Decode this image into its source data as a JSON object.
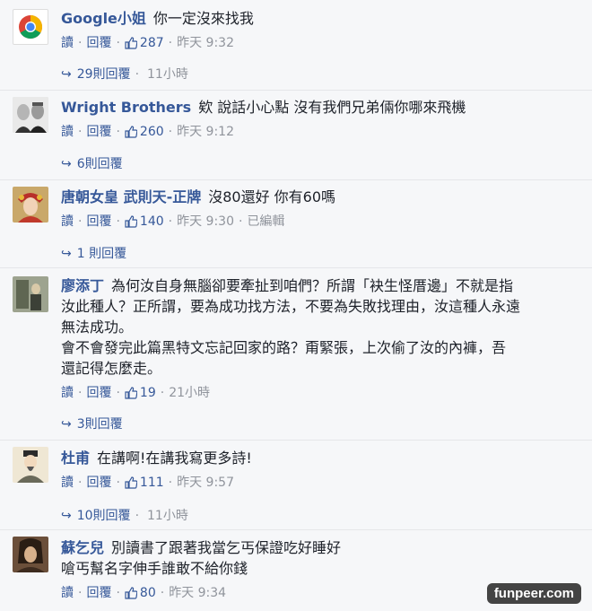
{
  "comments": [
    {
      "author": "Google小姐",
      "text": [
        "你一定沒來找我"
      ],
      "actions": {
        "read": "讀",
        "reply": "回覆",
        "likes": "287",
        "time": "昨天 9:32"
      },
      "replies": {
        "count": "29則回覆",
        "meta": "11小時"
      }
    },
    {
      "author": "Wright Brothers",
      "text": [
        "欸 說話小心點 沒有我們兄弟倆你哪來飛機"
      ],
      "actions": {
        "read": "讀",
        "reply": "回覆",
        "likes": "260",
        "time": "昨天 9:12"
      },
      "replies": {
        "count": "6則回覆",
        "meta": ""
      }
    },
    {
      "author": "唐朝女皇 武則天-正牌",
      "text": [
        "沒80還好 你有60嗎"
      ],
      "actions": {
        "read": "讀",
        "reply": "回覆",
        "likes": "140",
        "time": "昨天 9:30",
        "edited": "已編輯"
      },
      "replies": {
        "count": "1 則回覆",
        "meta": ""
      }
    },
    {
      "author": "廖添丁",
      "text": [
        "為何汝自身無腦卻要牽扯到咱們？所謂「袂生怪厝邊」不就是指",
        "汝此種人？正所謂，要為成功找方法，不要為失敗找理由，汝這種人永遠",
        "無法成功。",
        "會不會發完此篇黑特文忘記回家的路？甭緊張，上次偷了汝的內褲，吾",
        "還記得怎麼走。"
      ],
      "actions": {
        "read": "讀",
        "reply": "回覆",
        "likes": "19",
        "time": "21小時"
      },
      "replies": {
        "count": "3則回覆",
        "meta": ""
      }
    },
    {
      "author": "杜甫",
      "text": [
        "在講啊!在講我寫更多詩!"
      ],
      "actions": {
        "read": "讀",
        "reply": "回覆",
        "likes": "111",
        "time": "昨天 9:57"
      },
      "replies": {
        "count": "10則回覆",
        "meta": "11小時"
      }
    },
    {
      "author": "蘇乞兒",
      "text": [
        "別讀書了跟著我當乞丐保證吃好睡好",
        "嗆丐幫名字伸手誰敢不給你錢"
      ],
      "actions": {
        "read": "讀",
        "reply": "回覆",
        "likes": "80",
        "time": "昨天 9:34"
      },
      "replies": null
    }
  ],
  "watermark": "funpeer.com",
  "colors": {
    "link": "#365899",
    "meta": "#90949c",
    "text": "#1d2129",
    "bg": "#f6f7f9"
  }
}
